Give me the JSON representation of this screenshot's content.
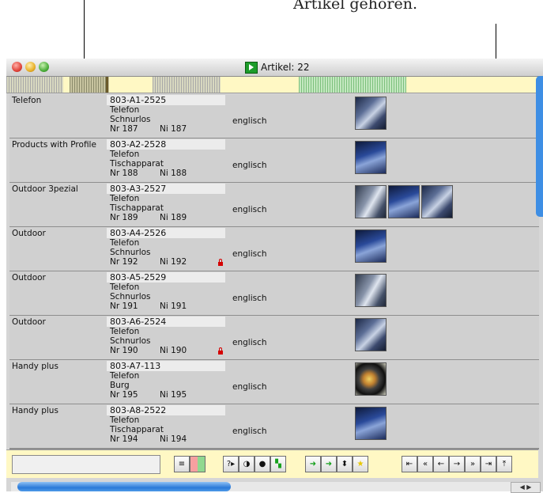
{
  "annotation": {
    "text": "Artikel gehören."
  },
  "window": {
    "title": "Artikel: 22"
  },
  "rows": [
    {
      "category": "Telefon",
      "code": "803-A1-2525",
      "line2": "Telefon",
      "line3": "Schnurlos",
      "nr": "Nr 187",
      "ni": "Ni 187",
      "language": "englisch",
      "locked": false
    },
    {
      "category": "Products with Profile",
      "code": "803-A2-2528",
      "line2": "Telefon",
      "line3": "Tischapparat",
      "nr": "Nr 188",
      "ni": "Ni 188",
      "language": "englisch",
      "locked": false
    },
    {
      "category": "Outdoor 3pezial",
      "code": "803-A3-2527",
      "line2": "Telefon",
      "line3": "Tischapparat",
      "nr": "Nr 189",
      "ni": "Ni 189",
      "language": "englisch",
      "locked": false
    },
    {
      "category": "Outdoor",
      "code": "803-A4-2526",
      "line2": "Telefon",
      "line3": "Schnurlos",
      "nr": "Nr 192",
      "ni": "Ni 192",
      "language": "englisch",
      "locked": true
    },
    {
      "category": "Outdoor",
      "code": "803-A5-2529",
      "line2": "Telefon",
      "line3": "Schnurlos",
      "nr": "Nr 191",
      "ni": "Ni 191",
      "language": "englisch",
      "locked": false
    },
    {
      "category": "Outdoor",
      "code": "803-A6-2524",
      "line2": "Telefon",
      "line3": "Schnurlos",
      "nr": "Nr 190",
      "ni": "Ni 190",
      "language": "englisch",
      "locked": true
    },
    {
      "category": "Handy plus",
      "code": "803-A7-113",
      "line2": "Telefon",
      "line3": "Burg",
      "nr": "Nr 195",
      "ni": "Ni 195",
      "language": "englisch",
      "locked": false
    },
    {
      "category": "Handy plus",
      "code": "803-A8-2522",
      "line2": "Telefon",
      "line3": "Tischapparat",
      "nr": "Nr 194",
      "ni": "Ni 194",
      "language": "englisch",
      "locked": false
    }
  ],
  "toolbar": {
    "help_label": "?▸"
  },
  "colors": {
    "stripe_background": "#fff8c4",
    "row_background": "#d0d0d0",
    "nav_green": "#16a01c",
    "lock_red": "#d40000",
    "scroll_blue": "#3e8ee4"
  }
}
